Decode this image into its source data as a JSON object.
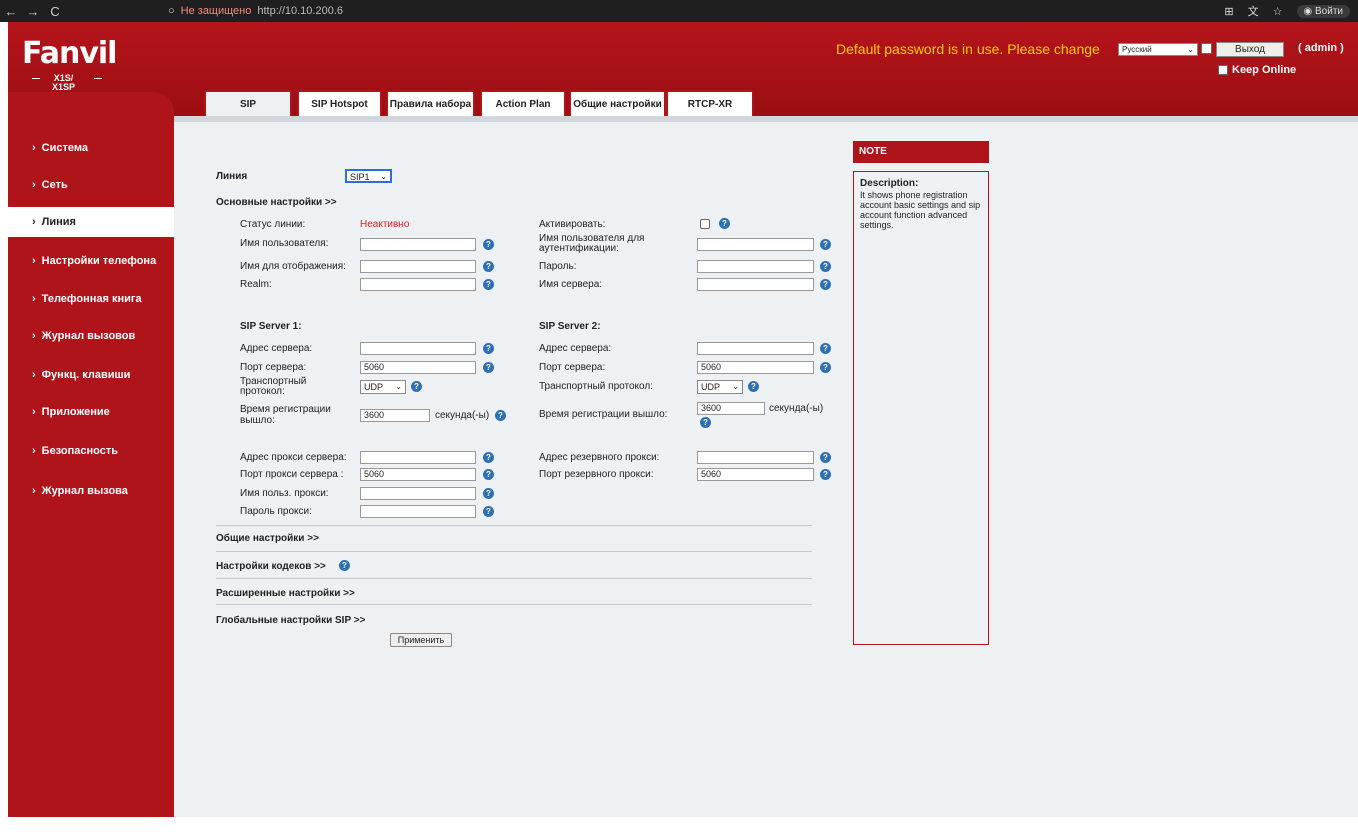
{
  "browser": {
    "back": "←",
    "forward": "→",
    "reload": "C",
    "secure_label": "Не защищено",
    "url": "http://10.10.200.6",
    "profile": "Войти"
  },
  "header": {
    "logo": "Fanvil",
    "model_line1": "X1S/",
    "model_line2": "X1SP",
    "warning": "Default password is in use. Please change",
    "language": "Русский",
    "logout": "Выход",
    "user": "( admin )",
    "keep_online": "Keep Online"
  },
  "sidebar": {
    "items": [
      {
        "label": "Система"
      },
      {
        "label": "Сеть"
      },
      {
        "label": "Линия"
      },
      {
        "label": "Настройки телефона"
      },
      {
        "label": "Телефонная книга"
      },
      {
        "label": "Журнал вызовов"
      },
      {
        "label": "Функц. клавиши"
      },
      {
        "label": "Приложение"
      },
      {
        "label": "Безопасность"
      },
      {
        "label": "Журнал вызова"
      }
    ]
  },
  "tabs": [
    "SIP",
    "SIP Hotspot",
    "Правила набора",
    "Action Plan",
    "Общие настройки",
    "RTCP-XR"
  ],
  "form": {
    "line_label": "Линия",
    "line_value": "SIP1",
    "basic_header": "Основные настройки >>",
    "status_label": "Статус линии:",
    "status_value": "Неактивно",
    "username_label": "Имя пользователя:",
    "display_name_label": "Имя для отображения:",
    "realm_label": "Realm:",
    "activate_label": "Активировать:",
    "auth_user_label": "Имя пользователя для аутентификации:",
    "password_label": "Пароль:",
    "server_name_label": "Имя сервера:",
    "sip1_header": "SIP Server 1:",
    "sip2_header": "SIP Server 2:",
    "server_addr_label": "Адрес сервера:",
    "server_port_label": "Порт сервера:",
    "transport_label": "Транспортный протокол:",
    "reg_expire_label": "Время регистрации вышло:",
    "port1_value": "5060",
    "port2_value": "5060",
    "transport1_value": "UDP",
    "transport2_value": "UDP",
    "expire1_value": "3600",
    "expire2_value": "3600",
    "seconds_label": "секунда(-ы)",
    "proxy_addr_label": "Адрес прокси сервера:",
    "proxy_port_label": "Порт прокси сервера :",
    "proxy_user_label": "Имя польз. прокси:",
    "proxy_pass_label": "Пароль прокси:",
    "backup_proxy_addr_label": "Адрес резервного прокси:",
    "backup_proxy_port_label": "Порт резервного прокси:",
    "proxy_port_value": "5060",
    "backup_proxy_port_value": "5060",
    "general_header": "Общие настройки >>",
    "codec_header": "Настройки кодеков >>",
    "advanced_header": "Расширенные настройки >>",
    "global_sip_header": "Глобальные настройки SIP >>",
    "apply": "Применить"
  },
  "note": {
    "header": "NOTE",
    "title": "Description:",
    "text": "It shows phone registration account basic settings and sip account function advanced settings."
  }
}
